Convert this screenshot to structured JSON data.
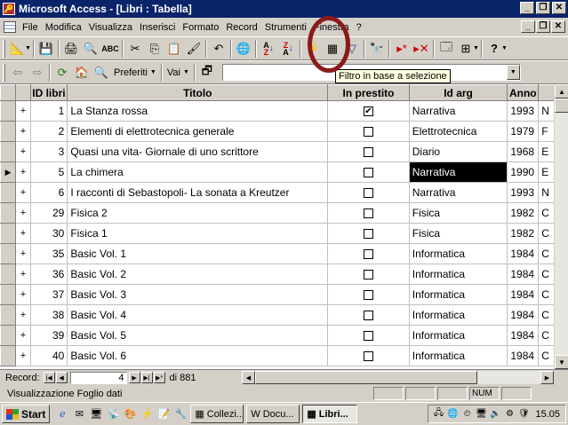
{
  "window": {
    "title": "Microsoft Access - [Libri : Tabella]",
    "minimize": "_",
    "restore": "❐",
    "close": "✕"
  },
  "menu": {
    "items": [
      "File",
      "Modifica",
      "Visualizza",
      "Inserisci",
      "Formato",
      "Record",
      "Strumenti",
      "Finestra",
      "?"
    ]
  },
  "toolbar2": {
    "favorites": "Preferiti",
    "go": "Vai"
  },
  "tooltip": "Filtro in base a selezione",
  "table": {
    "columns": [
      "ID libri",
      "Titolo",
      "In prestito",
      "Id arg",
      "Anno"
    ],
    "rows": [
      {
        "id": "1",
        "title": "La Stanza rossa",
        "lent": "☑",
        "arg": "Narrativa",
        "year": "1993",
        "extra": "N"
      },
      {
        "id": "2",
        "title": "Elementi di elettrotecnica generale",
        "lent": "☐",
        "arg": "Elettrotecnica",
        "year": "1979",
        "extra": "F"
      },
      {
        "id": "3",
        "title": "Quasi una vita- Giornale di uno scrittore",
        "lent": "☐",
        "arg": "Diario",
        "year": "1968",
        "extra": "E"
      },
      {
        "id": "5",
        "title": "La chimera",
        "lent": "☐",
        "arg": "Narrativa",
        "year": "1990",
        "extra": "E"
      },
      {
        "id": "6",
        "title": "I racconti di Sebastopoli- La sonata a Kreutzer",
        "lent": "☐",
        "arg": "Narrativa",
        "year": "1993",
        "extra": "N"
      },
      {
        "id": "29",
        "title": "Fisica 2",
        "lent": "☐",
        "arg": "Fisica",
        "year": "1982",
        "extra": "C"
      },
      {
        "id": "30",
        "title": "Fisica 1",
        "lent": "☐",
        "arg": "Fisica",
        "year": "1982",
        "extra": "C"
      },
      {
        "id": "35",
        "title": "Basic Vol. 1",
        "lent": "☐",
        "arg": "Informatica",
        "year": "1984",
        "extra": "C"
      },
      {
        "id": "36",
        "title": "Basic Vol. 2",
        "lent": "☐",
        "arg": "Informatica",
        "year": "1984",
        "extra": "C"
      },
      {
        "id": "37",
        "title": "Basic Vol. 3",
        "lent": "☐",
        "arg": "Informatica",
        "year": "1984",
        "extra": "C"
      },
      {
        "id": "38",
        "title": "Basic Vol. 4",
        "lent": "☐",
        "arg": "Informatica",
        "year": "1984",
        "extra": "C"
      },
      {
        "id": "39",
        "title": "Basic Vol. 5",
        "lent": "☐",
        "arg": "Informatica",
        "year": "1984",
        "extra": "C"
      },
      {
        "id": "40",
        "title": "Basic Vol. 6",
        "lent": "☐",
        "arg": "Informatica",
        "year": "1984",
        "extra": "C"
      }
    ]
  },
  "recordnav": {
    "label": "Record:",
    "current": "4",
    "total": "di 881"
  },
  "status": {
    "text": "Visualizzazione Foglio dati",
    "num": "NUM"
  },
  "taskbar": {
    "start": "Start",
    "tasks": [
      "Collezi...",
      "Docu...",
      "Libri..."
    ],
    "clock": "15.05"
  },
  "colors": {
    "titlebar": "#0a246a",
    "annotation_circle": "#8b1a1a",
    "tooltip_bg": "#ffffe1"
  }
}
